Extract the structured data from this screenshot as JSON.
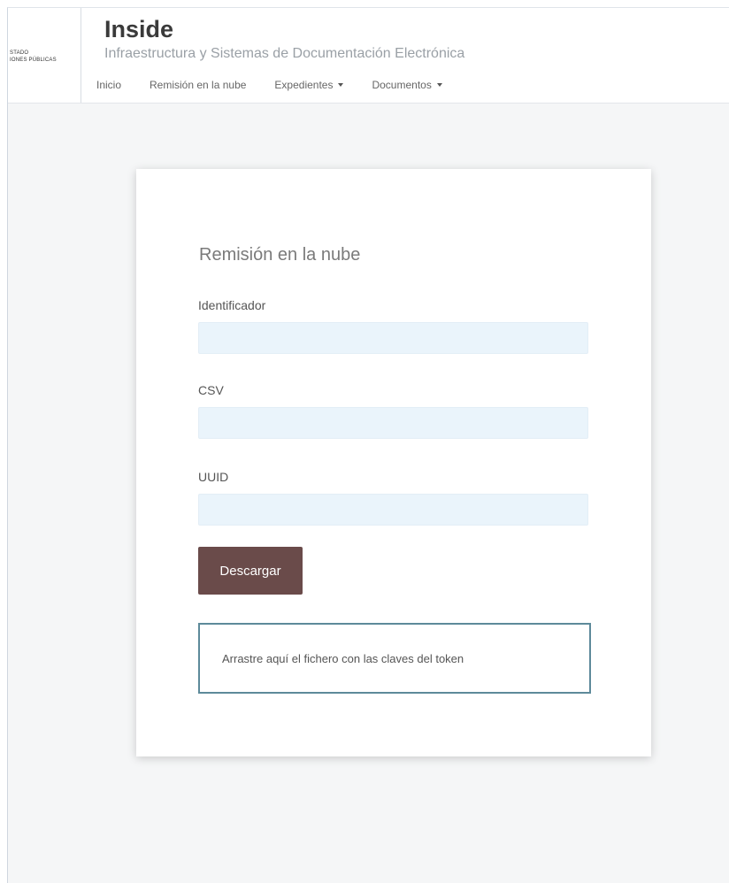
{
  "header": {
    "logo_lines": [
      "STADO",
      "IONES PÚBLICAS"
    ],
    "title": "Inside",
    "subtitle": "Infraestructura y Sistemas de Documentación Electrónica",
    "nav": [
      {
        "label": "Inicio",
        "dropdown": false
      },
      {
        "label": "Remisión en la nube",
        "dropdown": false
      },
      {
        "label": "Expedientes",
        "dropdown": true
      },
      {
        "label": "Documentos",
        "dropdown": true
      }
    ]
  },
  "form": {
    "title": "Remisión en la nube",
    "fields": [
      {
        "label": "Identificador",
        "value": ""
      },
      {
        "label": "CSV",
        "value": ""
      },
      {
        "label": "UUID",
        "value": ""
      }
    ],
    "download_label": "Descargar",
    "drop_zone_text": "Arrastre aquí el fichero con las claves del token"
  },
  "colors": {
    "button": "#6a4b4a",
    "input_background": "#eaf4fb",
    "drop_zone_border": "#5d8a9a"
  },
  "icons": {
    "nav_dropdown": "caret-down-icon"
  }
}
